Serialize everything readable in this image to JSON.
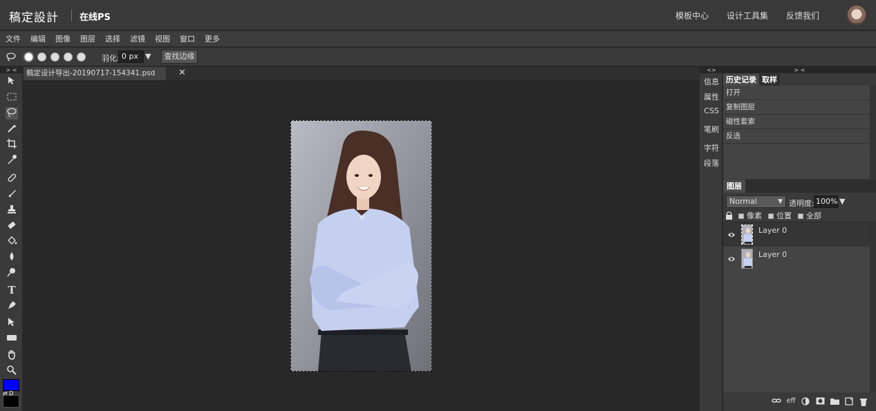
{
  "header": {
    "logo": "稿定設計",
    "product": "在线PS",
    "links": [
      "模板中心",
      "设计工具集",
      "反馈我们"
    ]
  },
  "menu": [
    "文件",
    "编辑",
    "图像",
    "图层",
    "选择",
    "滤镜",
    "视图",
    "窗口",
    "更多"
  ],
  "options": {
    "feather_label": "羽化:",
    "feather_value": "0  px",
    "refine_button": "查找边缘"
  },
  "toolbar": {
    "collapse": "> <",
    "foreground_color": "#0000ff",
    "background_color": "#000000",
    "swap_label": "⇄  D"
  },
  "document": {
    "tab_title": "稿定设计导出-20190717-154341.psd",
    "close": "✕"
  },
  "side_tabs": {
    "collapse": "<>",
    "items": [
      "信息",
      "属性",
      "CSS",
      "笔刷",
      "字符",
      "段落"
    ]
  },
  "history": {
    "collapse": "> <",
    "tabs": [
      "历史记录",
      "取样"
    ],
    "items": [
      "打开",
      "复制图层",
      "磁性套索",
      "反选"
    ]
  },
  "layers": {
    "title": "图层",
    "blend_mode": "Normal",
    "opacity_label": "透明度:",
    "opacity_value": "100%",
    "lock_labels": [
      "像素",
      "位置",
      "全部"
    ],
    "items": [
      {
        "name": "Layer 0",
        "selected": true
      },
      {
        "name": "Layer 0",
        "selected": false
      }
    ],
    "footer_icons": [
      "link-icon",
      "effects-icon",
      "adjustment-icon",
      "mask-icon",
      "folder-icon",
      "new-layer-icon",
      "trash-icon"
    ],
    "effects_label": "eff"
  }
}
